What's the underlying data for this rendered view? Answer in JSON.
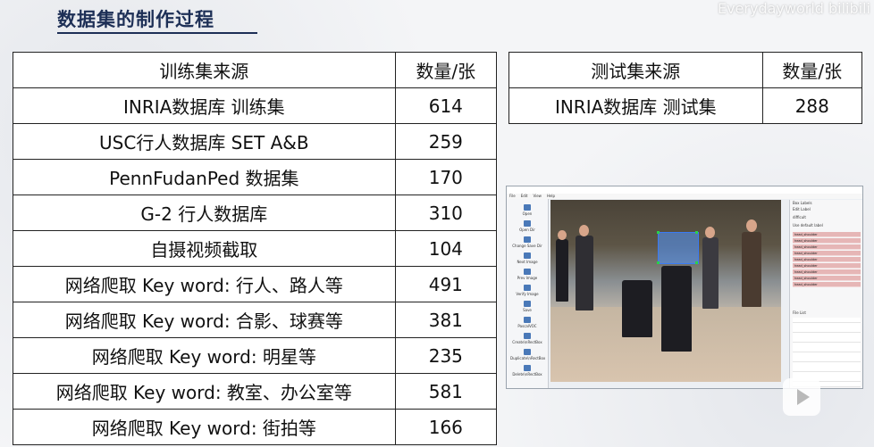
{
  "slide": {
    "title": "数据集的制作过程",
    "watermark": "Everydayworld bilibili"
  },
  "train_table": {
    "header_source": "训练集来源",
    "header_count": "数量/张",
    "rows": [
      {
        "source": "INRIA数据库 训练集",
        "count": "614"
      },
      {
        "source": "USC行人数据库 SET A&B",
        "count": "259"
      },
      {
        "source": "PennFudanPed 数据集",
        "count": "170"
      },
      {
        "source": "G-2 行人数据库",
        "count": "310"
      },
      {
        "source": "自摄视频截取",
        "count": "104"
      },
      {
        "source": "网络爬取 Key word: 行人、路人等",
        "count": "491"
      },
      {
        "source": "网络爬取 Key word: 合影、球赛等",
        "count": "381"
      },
      {
        "source": "网络爬取 Key word: 明星等",
        "count": "235"
      },
      {
        "source": "网络爬取 Key word: 教室、办公室等",
        "count": "581"
      },
      {
        "source": "网络爬取 Key word: 街拍等",
        "count": "166"
      }
    ]
  },
  "test_table": {
    "header_source": "测试集来源",
    "header_count": "数量/张",
    "rows": [
      {
        "source": "INRIA数据库 测试集",
        "count": "288"
      }
    ]
  },
  "labeling_tool": {
    "menu": [
      "File",
      "Edit",
      "View",
      "Help"
    ],
    "tools": [
      "Open",
      "Open Dir",
      "Change Save Dir",
      "Next Image",
      "Prev Image",
      "Verify Image",
      "Save",
      "PascalVOC",
      "Create\\nRectBox",
      "Duplicate\\nRectBox",
      "Delete\\nRectBox"
    ],
    "box_labels_title": "Box Labels",
    "edit_label": "Edit Label",
    "difficult": "difficult",
    "use_default_label": "Use default label",
    "labels": [
      "head_shoulder",
      "head_shoulder",
      "head_shoulder",
      "head_shoulder",
      "head_shoulder",
      "head_shoulder",
      "head_shoulder",
      "head_shoulder",
      "head_shoulder"
    ],
    "file_list_title": "File List"
  }
}
